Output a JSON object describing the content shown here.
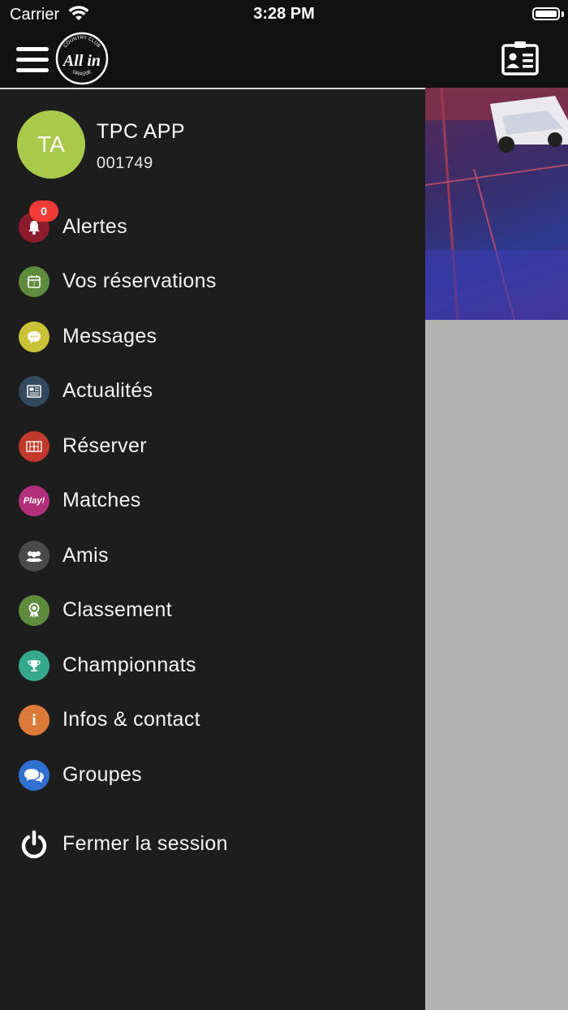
{
  "status_bar": {
    "carrier": "Carrier",
    "time": "3:28 PM"
  },
  "header": {
    "logo_text": "All in",
    "logo_ring_top": "COUNTRY CLUB",
    "logo_ring_bottom": "GRASSE"
  },
  "user": {
    "initials": "TA",
    "name": "TPC APP",
    "id": "001749"
  },
  "menu": [
    {
      "label": "Alertes",
      "icon": "bell-icon",
      "color": "#8e1b2b",
      "badge": "0"
    },
    {
      "label": "Vos réservations",
      "icon": "calendar-icon",
      "color": "#5e8c3c"
    },
    {
      "label": "Messages",
      "icon": "chat-bubble-icon",
      "color": "#c9c236"
    },
    {
      "label": "Actualités",
      "icon": "newspaper-icon",
      "color": "#34495e"
    },
    {
      "label": "Réserver",
      "icon": "court-icon",
      "color": "#c0392b"
    },
    {
      "label": "Matches",
      "icon": "play-icon",
      "color": "#b2307a",
      "icon_text": "Play!"
    },
    {
      "label": "Amis",
      "icon": "friends-icon",
      "color": "#4a4a4a"
    },
    {
      "label": "Classement",
      "icon": "award-icon",
      "color": "#5e8c3c"
    },
    {
      "label": "Championnats",
      "icon": "trophy-icon",
      "color": "#36a88e"
    },
    {
      "label": "Infos & contact",
      "icon": "info-icon",
      "color": "#dd7a3a",
      "icon_text": "i"
    },
    {
      "label": "Groupes",
      "icon": "groups-icon",
      "color": "#2f6fcf"
    }
  ],
  "logout": {
    "label": "Fermer la session",
    "icon": "power-icon"
  }
}
